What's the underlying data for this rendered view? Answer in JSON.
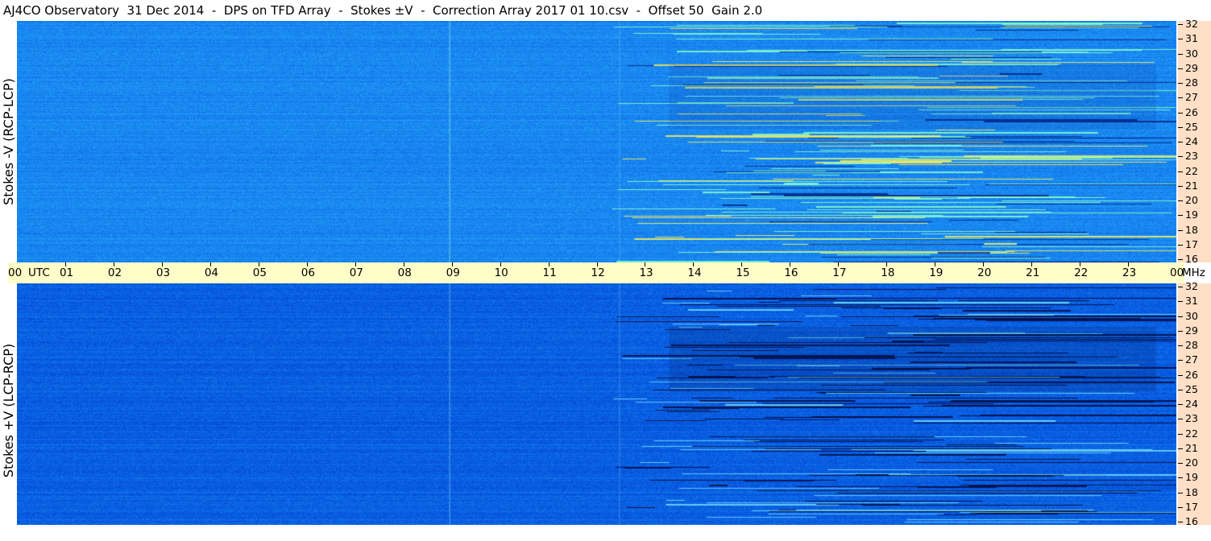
{
  "header": {
    "title": "AJ4CO Observatory  31 Dec 2014  -  DPS on TFD Array  -  Stokes ±V  -  Correction Array 2017 01 10.csv  -  Offset 50  Gain 2.0"
  },
  "panels": {
    "top": {
      "label": "Stokes -V (RCP-LCP)"
    },
    "bottom": {
      "label": "Stokes +V (LCP-RCP)"
    }
  },
  "time_axis": {
    "start_label": "00",
    "unit_label": "UTC",
    "end_label": "00",
    "freq_unit_label": "MHz",
    "hours": [
      "01",
      "02",
      "03",
      "04",
      "05",
      "06",
      "07",
      "08",
      "09",
      "10",
      "11",
      "12",
      "13",
      "14",
      "15",
      "16",
      "17",
      "18",
      "19",
      "20",
      "21",
      "22",
      "23"
    ]
  },
  "freq_axis": {
    "labels": [
      "32",
      "31",
      "30",
      "29",
      "28",
      "27",
      "26",
      "25",
      "24",
      "23",
      "22",
      "21",
      "20",
      "19",
      "18",
      "17",
      "16"
    ]
  },
  "colors": {
    "spectrogram_base": "#1e8cf0",
    "spectrogram_dark": "#0050d6",
    "time_axis_bg": "#fffdc8",
    "freq_axis_bg": "#ffdfc6"
  }
}
